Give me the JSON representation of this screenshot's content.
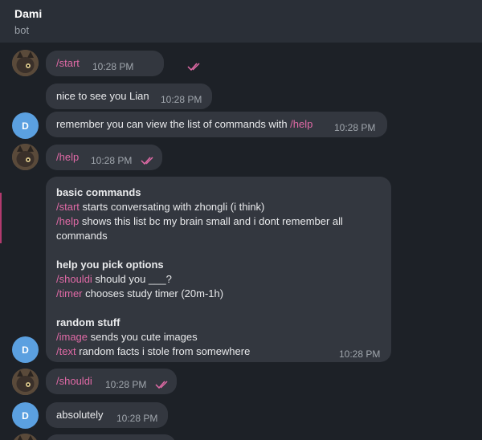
{
  "header": {
    "name": "Dami",
    "status": "bot"
  },
  "messages": {
    "m1": {
      "text": "/start",
      "time": "10:28 PM"
    },
    "m2": {
      "text": "nice to see you Lian",
      "time": "10:28 PM"
    },
    "m3": {
      "text": "remember you can view the list of commands with ",
      "cmd": "/help",
      "time": "10:28 PM"
    },
    "m4": {
      "text": "/help",
      "time": "10:28 PM"
    },
    "m5": {
      "time": "10:28 PM",
      "h1": "basic commands",
      "l1_cmd": "/start",
      "l1": " starts conversating with zhongli (i think)",
      "l2_cmd": "/help",
      "l2": " shows this list bc my brain small and i dont remember all",
      "l2b": "commands",
      "h2": "help you pick options",
      "l3_cmd": "/shouldi",
      "l3": " should you ___?",
      "l4_cmd": "/timer",
      "l4": " chooses study timer (20m-1h)",
      "h3": "random stuff",
      "l5_cmd": "/image",
      "l5": " sends you cute images",
      "l6_cmd": "/text",
      "l6": " random facts i stole from somewhere"
    },
    "m6": {
      "text": "/shouldi",
      "time": "10:28 PM"
    },
    "m7": {
      "text": "absolutely",
      "time": "10:28 PM"
    }
  },
  "avatars": {
    "bot_initial": "D",
    "user_icon": "cat-avatar-icon"
  },
  "colors": {
    "accent": "#e06aa6",
    "bubble": "#33373f",
    "avatar_bot": "#5ba0e0"
  }
}
